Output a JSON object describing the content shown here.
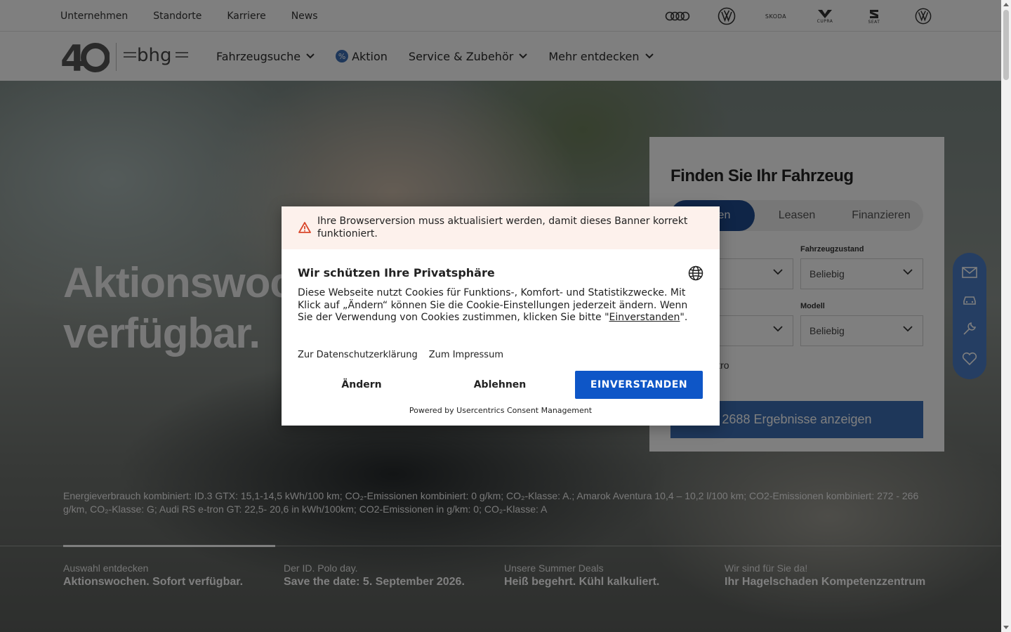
{
  "topbar": {
    "links": [
      "Unternehmen",
      "Standorte",
      "Karriere",
      "News"
    ],
    "brands": [
      {
        "name": "audi-logo",
        "label": ""
      },
      {
        "name": "vw-logo",
        "label": ""
      },
      {
        "name": "skoda-logo",
        "label": "SKODA"
      },
      {
        "name": "cupra-logo",
        "label": "CUPRA"
      },
      {
        "name": "seat-logo",
        "label": "SEAT"
      },
      {
        "name": "vw-nutzfahrzeuge-logo",
        "label": ""
      }
    ]
  },
  "header": {
    "nav": {
      "fahrzeugsuche": "Fahrzeugsuche",
      "aktion": "Aktion",
      "aktion_symbol": "%",
      "service": "Service & Zubehör",
      "mehr": "Mehr entdecken"
    }
  },
  "hero": {
    "title_line1": "Aktionswochen. Sofort",
    "title_line2": "verfügbar.",
    "energy": "Energieverbrauch kombiniert: ID.3 GTX: 15,1-14,5 kWh/100 km; CO₂-Emissionen kombiniert: 0 g/km; CO₂-Klasse: A.; Amarok Aventura 10,4 – 10,2 l/100 km; CO2-Emissionen kombiniert: 272 - 266 g/km, CO₂-Klasse: G; Audi RS e-tron GT: 22,5- 20,6 in kWh/100km; CO2-Emissionen in g/km: 0; CO₂-Klasse: A",
    "slides": [
      {
        "kicker": "Auswahl entdecken",
        "title": "Aktionswochen. Sofort verfügbar."
      },
      {
        "kicker": "Der ID. Polo day.",
        "title": "Save the date: 5. September 2026."
      },
      {
        "kicker": "Unsere Summer Deals",
        "title": "Heiß begehrt. Kühl kalkuliert."
      },
      {
        "kicker": "Wir sind für Sie da!",
        "title": "Ihr Hagelschaden Kompetenzzentrum"
      }
    ]
  },
  "search": {
    "title": "Finden Sie Ihr Fahrzeug",
    "tabs": [
      "Kaufen",
      "Leasen",
      "Finanzieren"
    ],
    "fahrzeugzustand_label": "Fahrzeugzustand",
    "fahrzeugzustand_value": "Beliebig",
    "modell_label": "Modell",
    "modell_value": "Beliebig",
    "marke_value": "",
    "typ_value": "",
    "elektro_label": "Elektro",
    "results_button": "2688 Ergebnisse anzeigen"
  },
  "consent": {
    "warning": "Ihre Browserversion muss aktualisiert werden, damit dieses Banner korrekt funktioniert.",
    "title": "Wir schützen Ihre Privatsphäre",
    "body_pre": "Diese Webseite nutzt Cookies für Funktions-, Komfort- und Statistikzwecke. Mit Klick auf „Ändern“ können Sie die Cookie-Einstellungen jederzeit ändern. Wenn Sie der Verwendung von Cookies zustimmen, klicken Sie bitte \"",
    "body_link": "Einverstanden",
    "body_post": "\".",
    "link_privacy": "Zur Datenschutzerklärung",
    "link_imprint": "Zum Impressum",
    "btn_change": "Ändern",
    "btn_reject": "Ablehnen",
    "btn_accept": "EINVERSTANDEN",
    "powered": "Powered by Usercentrics Consent Management"
  },
  "colors": {
    "accent": "#3d6fb5",
    "accept_button": "#0e56c7",
    "warning_bg": "#fdf1ec",
    "warning_icon": "#d9472b"
  }
}
